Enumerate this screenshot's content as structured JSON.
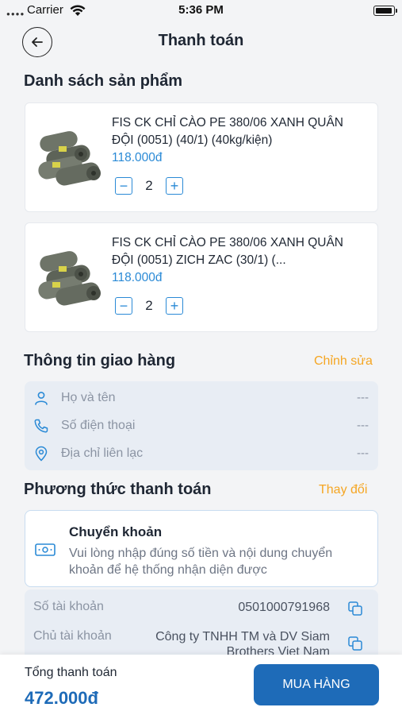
{
  "status_bar": {
    "carrier": "Carrier",
    "time": "5:36 PM"
  },
  "header": {
    "title": "Thanh toán"
  },
  "products_section": {
    "title": "Danh sách sản phẩm",
    "items": [
      {
        "name": "FIS CK CHỈ CÀO PE 380/06 XANH QUÂN ĐỘI (0051) (40/1) (40kg/kiện)",
        "price": "118.000đ",
        "quantity": "2"
      },
      {
        "name": "FIS CK CHỈ CÀO PE 380/06 XANH QUÂN ĐỘI (0051) ZICH ZAC (30/1) (...",
        "price": "118.000đ",
        "quantity": "2"
      }
    ],
    "minus_symbol": "−",
    "plus_symbol": "+"
  },
  "delivery": {
    "title": "Thông tin giao hàng",
    "action": "Chỉnh sửa",
    "fields": [
      {
        "icon": "user-icon",
        "label": "Họ và tên",
        "value": "---"
      },
      {
        "icon": "phone-icon",
        "label": "Số điện thoại",
        "value": "---"
      },
      {
        "icon": "location-pin-icon",
        "label": "Địa chỉ liên lạc",
        "value": "---"
      }
    ]
  },
  "payment": {
    "title": "Phương thức thanh toán",
    "action": "Thay đổi",
    "method": {
      "icon": "banknote-icon",
      "name": "Chuyển khoản",
      "description": "Vui lòng nhập đúng số tiền và nội dung chuyển khoản để hệ thống nhận diện được"
    },
    "account": [
      {
        "label": "Số tài khoản",
        "value": "0501000791968"
      },
      {
        "label": "Chủ tài khoản",
        "value": "Công ty TNHH TM và DV Siam Brothers Viet Nam"
      }
    ]
  },
  "footer": {
    "total_label": "Tổng thanh toán",
    "total_value": "472.000đ",
    "buy_label": "MUA HÀNG"
  },
  "colors": {
    "primary": "#1e6bb8",
    "price": "#2a8ad6",
    "action": "#f5a623",
    "muted": "#8b94a3",
    "background": "#f3f4f6"
  }
}
